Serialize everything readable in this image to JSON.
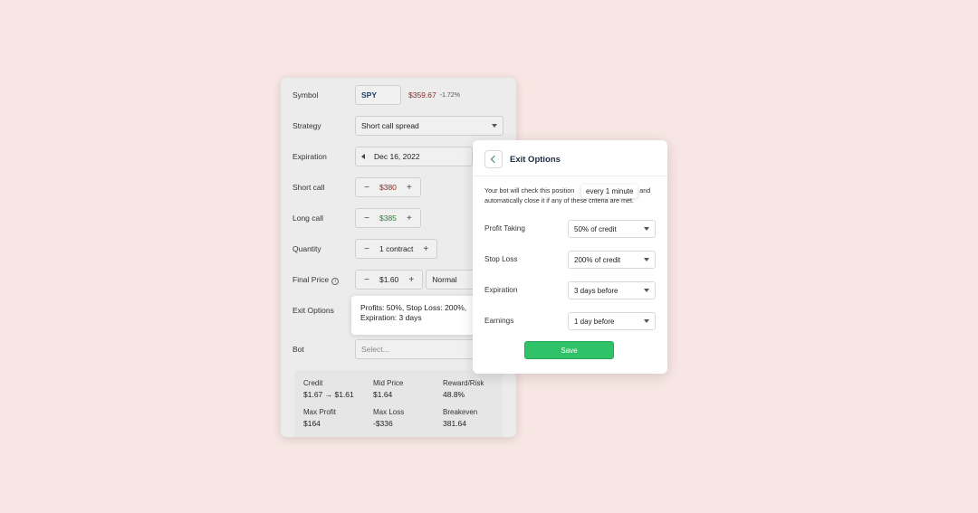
{
  "form": {
    "symbol": {
      "label": "Symbol",
      "value": "SPY",
      "price": "$359.67",
      "change": "-1.72%"
    },
    "strategy": {
      "label": "Strategy",
      "value": "Short call spread"
    },
    "expiration": {
      "label": "Expiration",
      "value": "Dec 16, 2022"
    },
    "short_call": {
      "label": "Short call",
      "value": "$380"
    },
    "long_call": {
      "label": "Long call",
      "value": "$385"
    },
    "quantity": {
      "label": "Quantity",
      "value": "1 contract"
    },
    "final_price": {
      "label": "Final Price",
      "value": "$1.60",
      "mode": "Normal"
    },
    "exit_options": {
      "label": "Exit Options",
      "summary_line1": "Profits: 50%, Stop Loss: 200%,",
      "summary_line2": "Expiration: 3 days"
    },
    "bot": {
      "label": "Bot",
      "placeholder": "Select..."
    },
    "summary": {
      "credit": {
        "label": "Credit",
        "value": "$1.67 → $1.61"
      },
      "mid_price": {
        "label": "Mid Price",
        "value": "$1.64"
      },
      "reward_risk": {
        "label": "Reward/Risk",
        "value": "48.8%"
      },
      "max_profit": {
        "label": "Max Profit",
        "value": "$164"
      },
      "max_loss": {
        "label": "Max Loss",
        "value": "-$336"
      },
      "breakeven": {
        "label": "Breakeven",
        "value": "381.64"
      }
    }
  },
  "modal": {
    "title": "Exit Options",
    "desc_before": "Your bot will check this position",
    "desc_chip": "every 1 minute",
    "desc_after": "and",
    "desc_line2": "automatically close it if any of these criteria are met.",
    "options": [
      {
        "label": "Profit Taking",
        "value": "50% of credit"
      },
      {
        "label": "Stop Loss",
        "value": "200% of credit"
      },
      {
        "label": "Expiration",
        "value": "3 days before"
      },
      {
        "label": "Earnings",
        "value": "1 day before"
      }
    ],
    "save_label": "Save"
  },
  "colors": {
    "background": "#f7e6e3",
    "accent_green": "#2fc269",
    "negative": "#8a2a2a",
    "positive": "#2f7a3a"
  }
}
